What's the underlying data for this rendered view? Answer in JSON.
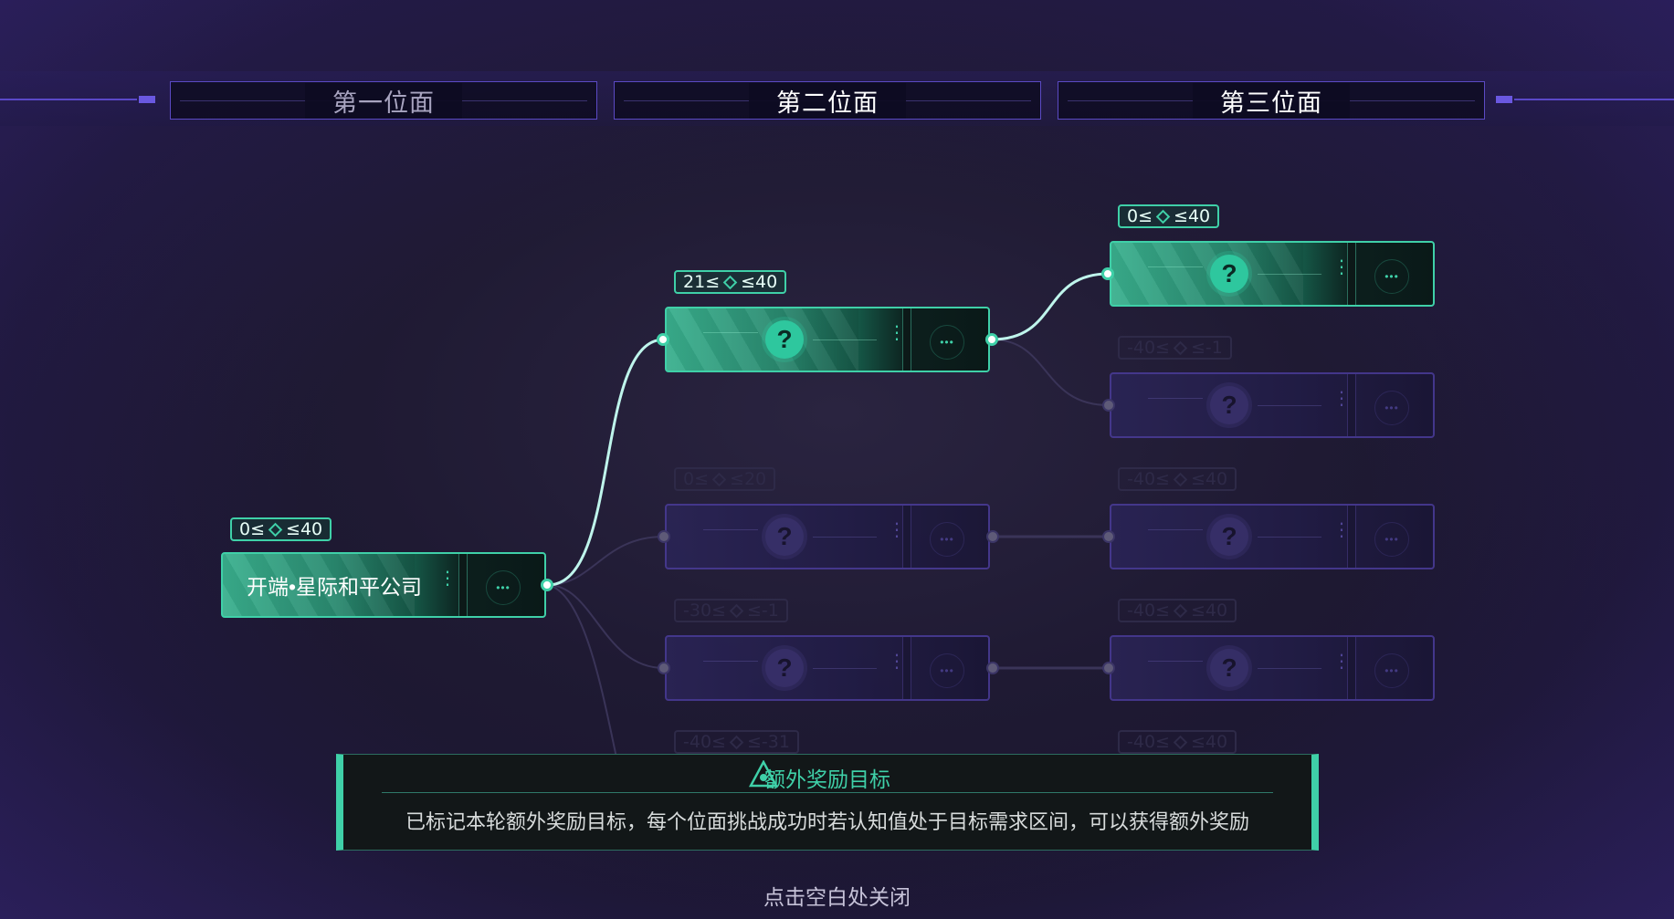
{
  "headers": [
    {
      "label": "第一位面"
    },
    {
      "label": "第二位面"
    },
    {
      "label": "第三位面"
    }
  ],
  "nodes": {
    "start": {
      "label": "开端•星际和平公司",
      "range": {
        "min": "0",
        "max": "40"
      }
    },
    "n2a": {
      "range": {
        "min": "21",
        "max": "40"
      }
    },
    "n2b": {
      "range": {
        "min": "0",
        "max": "20"
      }
    },
    "n2c": {
      "range": {
        "min": "-30",
        "max": "-1"
      }
    },
    "n2d": {
      "range": {
        "min": "-40",
        "max": "-31"
      }
    },
    "n3a": {
      "range": {
        "min": "0",
        "max": "40"
      }
    },
    "n3b": {
      "range": {
        "min": "-40",
        "max": "-1"
      }
    },
    "n3c": {
      "range": {
        "min": "-40",
        "max": "40"
      }
    },
    "n3d": {
      "range": {
        "min": "-40",
        "max": "40"
      }
    },
    "n3e": {
      "range": {
        "min": "-40",
        "max": "40"
      }
    }
  },
  "symbols": {
    "le": "≤",
    "unknown": "?",
    "more": "•••",
    "menu": "⋮"
  },
  "bonus_panel": {
    "title": "额外奖励目标",
    "description": "已标记本轮额外奖励目标，每个位面挑战成功时若认知值处于目标需求区间，可以获得额外奖励"
  },
  "close_hint": "点击空白处关闭",
  "colors": {
    "accent": "#3fd0a8",
    "inactive_border": "#4a3c9a",
    "background": "#1f1a33"
  }
}
